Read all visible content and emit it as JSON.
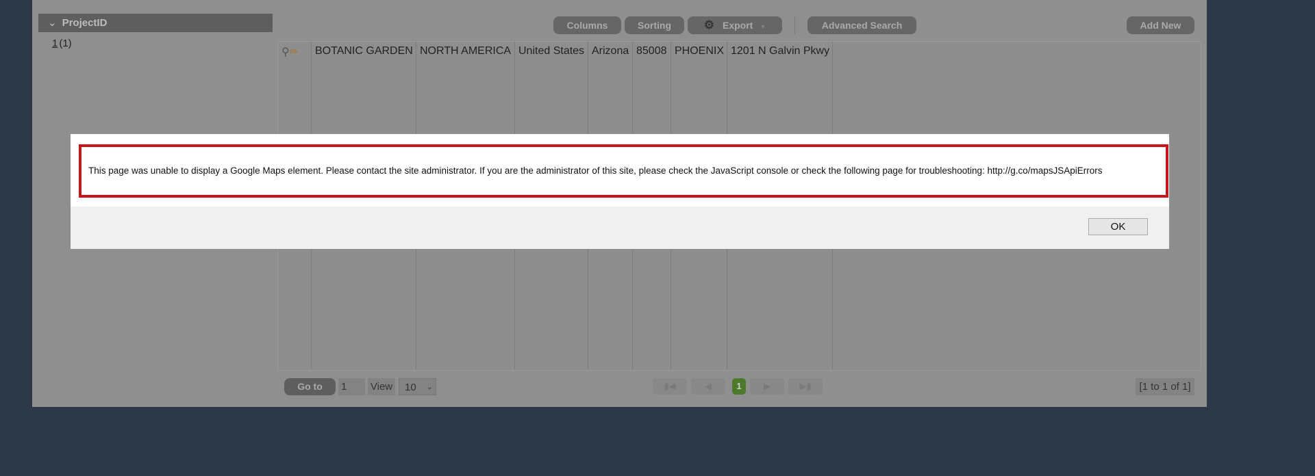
{
  "sidebar": {
    "header": "ProjectID",
    "items": [
      {
        "link": "1",
        "count": "(1)"
      }
    ]
  },
  "toolbar": {
    "columns": "Columns",
    "sorting": "Sorting",
    "export": "Export",
    "advanced_search": "Advanced Search",
    "add_new": "Add New"
  },
  "table": {
    "rows": [
      [
        "BOTANIC GARDEN",
        "NORTH AMERICA",
        "United States",
        "Arizona",
        "85008",
        "PHOENIX",
        "1201 N Galvin Pkwy"
      ]
    ]
  },
  "footer": {
    "goto": "Go to",
    "page_value": "1",
    "view": "View",
    "view_value": "10",
    "current_page": "1",
    "info": "[1 to 1 of 1]"
  },
  "dialog": {
    "message": "This page was unable to display a Google Maps element. Please contact the site administrator. If you are the administrator of this site, please check the JavaScript console or check the following page for troubleshooting: http://g.co/mapsJSApiErrors",
    "ok": "OK"
  },
  "colors": {
    "background": "#2d3848",
    "alert_border": "#c8141c",
    "current_page": "#4a7a2a"
  }
}
